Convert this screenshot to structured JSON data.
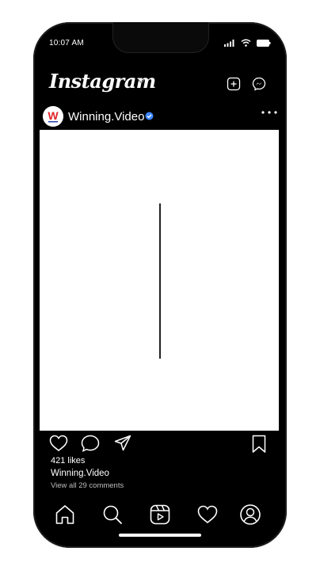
{
  "status_bar": {
    "time": "10:07 AM"
  },
  "header": {
    "logo_text": "Instagram"
  },
  "post": {
    "username": "Winning.Video",
    "avatar_letter": "W",
    "likes_text": "421 likes",
    "caption_username": "Winning.Video",
    "view_comments_text": "View all 29 comments"
  },
  "colors": {
    "background": "#000000",
    "verified": "#3d86ff",
    "avatar_brand_red": "#e0262b",
    "avatar_brand_blue": "#2b3fa8"
  },
  "icons": {
    "header": [
      "new-post-icon",
      "messenger-icon"
    ],
    "actions": [
      "heart-icon",
      "comment-icon",
      "share-icon",
      "bookmark-icon"
    ],
    "tabs": [
      "home-icon",
      "search-icon",
      "reels-icon",
      "activity-heart-icon",
      "profile-icon"
    ]
  }
}
